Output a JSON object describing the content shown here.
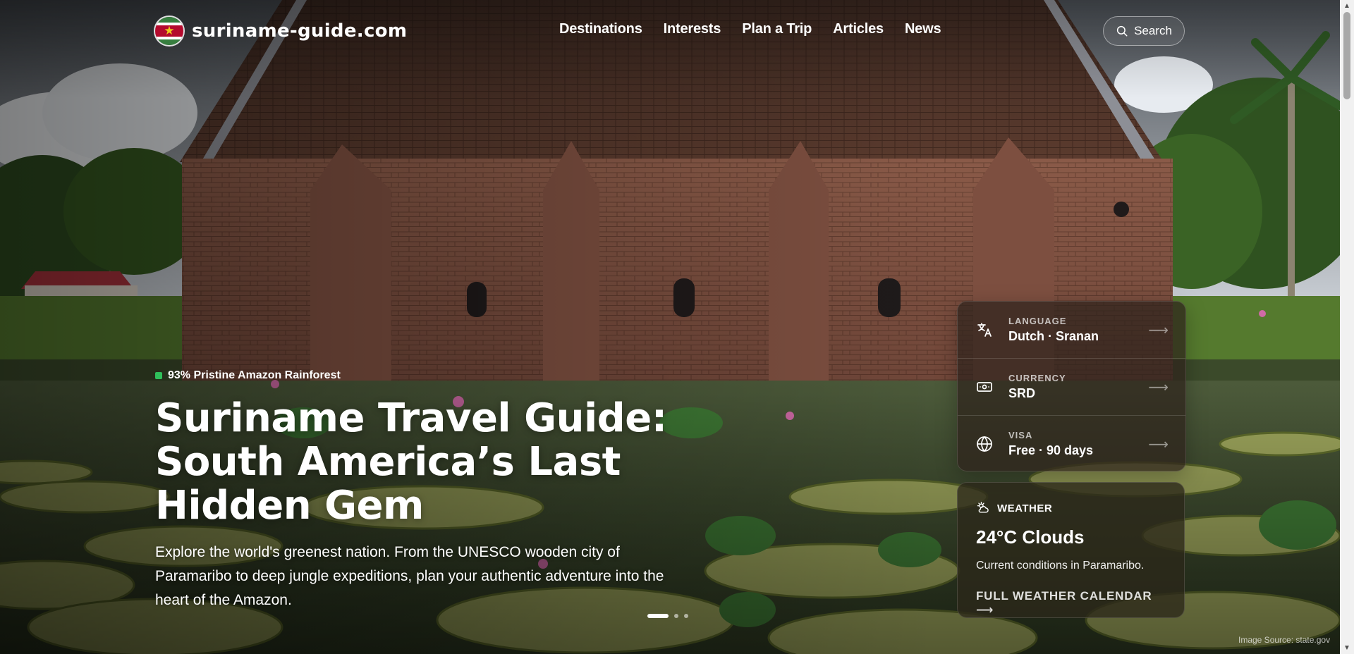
{
  "site": {
    "name": "suriname-guide.com",
    "flag_star": "★"
  },
  "nav": {
    "items": [
      "Destinations",
      "Interests",
      "Plan a Trip",
      "Articles",
      "News"
    ]
  },
  "search": {
    "label": "Search"
  },
  "hero": {
    "badge": "93% Pristine Amazon Rainforest",
    "title": "Suriname Travel Guide: South America’s Last Hidden Gem",
    "description": "Explore the world's greenest nation. From the UNESCO wooden city of Paramaribo to deep jungle expeditions, plan your authentic adventure into the heart of the Amazon.",
    "slides": {
      "count": 3,
      "active": 1
    },
    "image_credit": "Image Source: state.gov"
  },
  "facts": [
    {
      "label": "LANGUAGE",
      "value": "Dutch · Sranan",
      "icon": "translate-icon",
      "arrow": "⟶"
    },
    {
      "label": "CURRENCY",
      "value": "SRD",
      "icon": "banknote-icon",
      "arrow": "⟶"
    },
    {
      "label": "VISA",
      "value": "Free · 90 days",
      "icon": "globe-icon",
      "arrow": "⟶"
    }
  ],
  "weather": {
    "heading": "WEATHER",
    "icon": "partly-cloudy-icon",
    "current": "24°C Clouds",
    "subtitle": "Current conditions in Paramaribo.",
    "link": "FULL WEATHER CALENDAR ⟶"
  },
  "colors": {
    "accent_green": "#2fbf5a",
    "flag_green": "#377e3f",
    "flag_red": "#b40a2d",
    "flag_yellow": "#ecc81d"
  }
}
